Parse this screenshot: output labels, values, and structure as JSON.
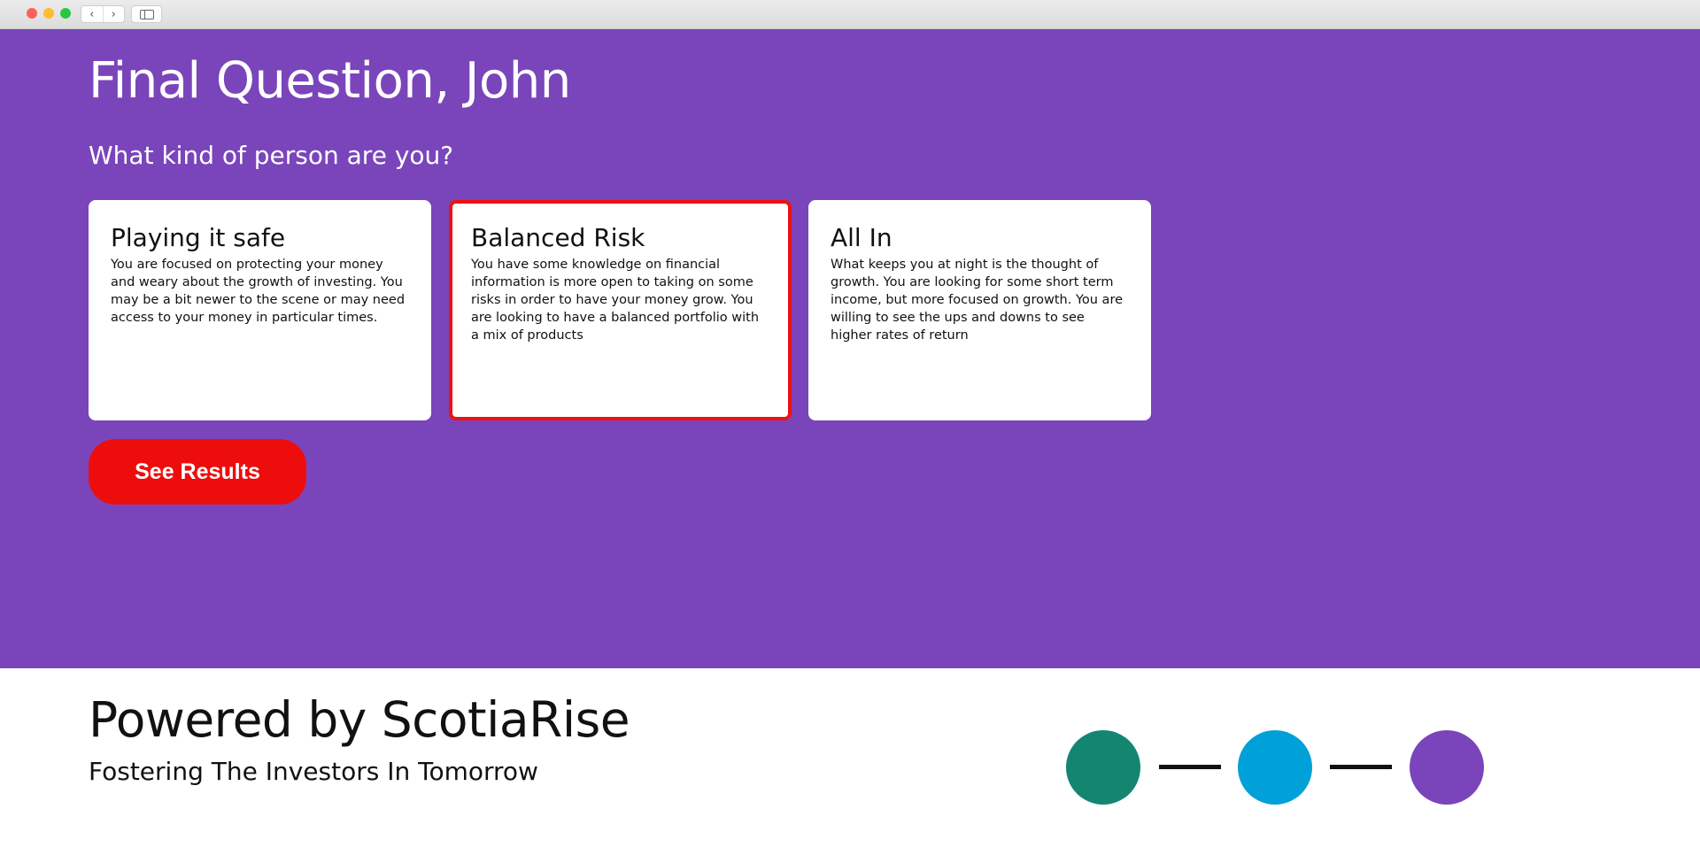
{
  "browser": {
    "back_icon": "‹",
    "forward_icon": "›"
  },
  "hero": {
    "title": "Final Question, John",
    "question": "What kind of person are you?",
    "background_color": "#7a45bb",
    "options": [
      {
        "title": "Playing it safe",
        "description": "You are focused on protecting your money and weary about the growth of investing. You may be a bit newer to the scene or may need access to your money in particular times.",
        "selected": false
      },
      {
        "title": "Balanced Risk",
        "description": "You have some knowledge on financial information is more open to taking on some risks in order to have your money grow. You are looking to have a balanced portfolio with a mix of products",
        "selected": true
      },
      {
        "title": "All In",
        "description": "What keeps you at night is the thought of growth. You are looking for some short term income, but more focused on growth. You are willing to see the ups and downs to see higher rates of return",
        "selected": false
      }
    ],
    "results_button": "See Results",
    "accent_color": "#ee0d0d"
  },
  "footer": {
    "brand": "Powered by ScotiaRise",
    "tagline": "Fostering The Investors In Tomorrow",
    "step_colors": [
      "#138672",
      "#00a1d8",
      "#7a45bb"
    ]
  }
}
